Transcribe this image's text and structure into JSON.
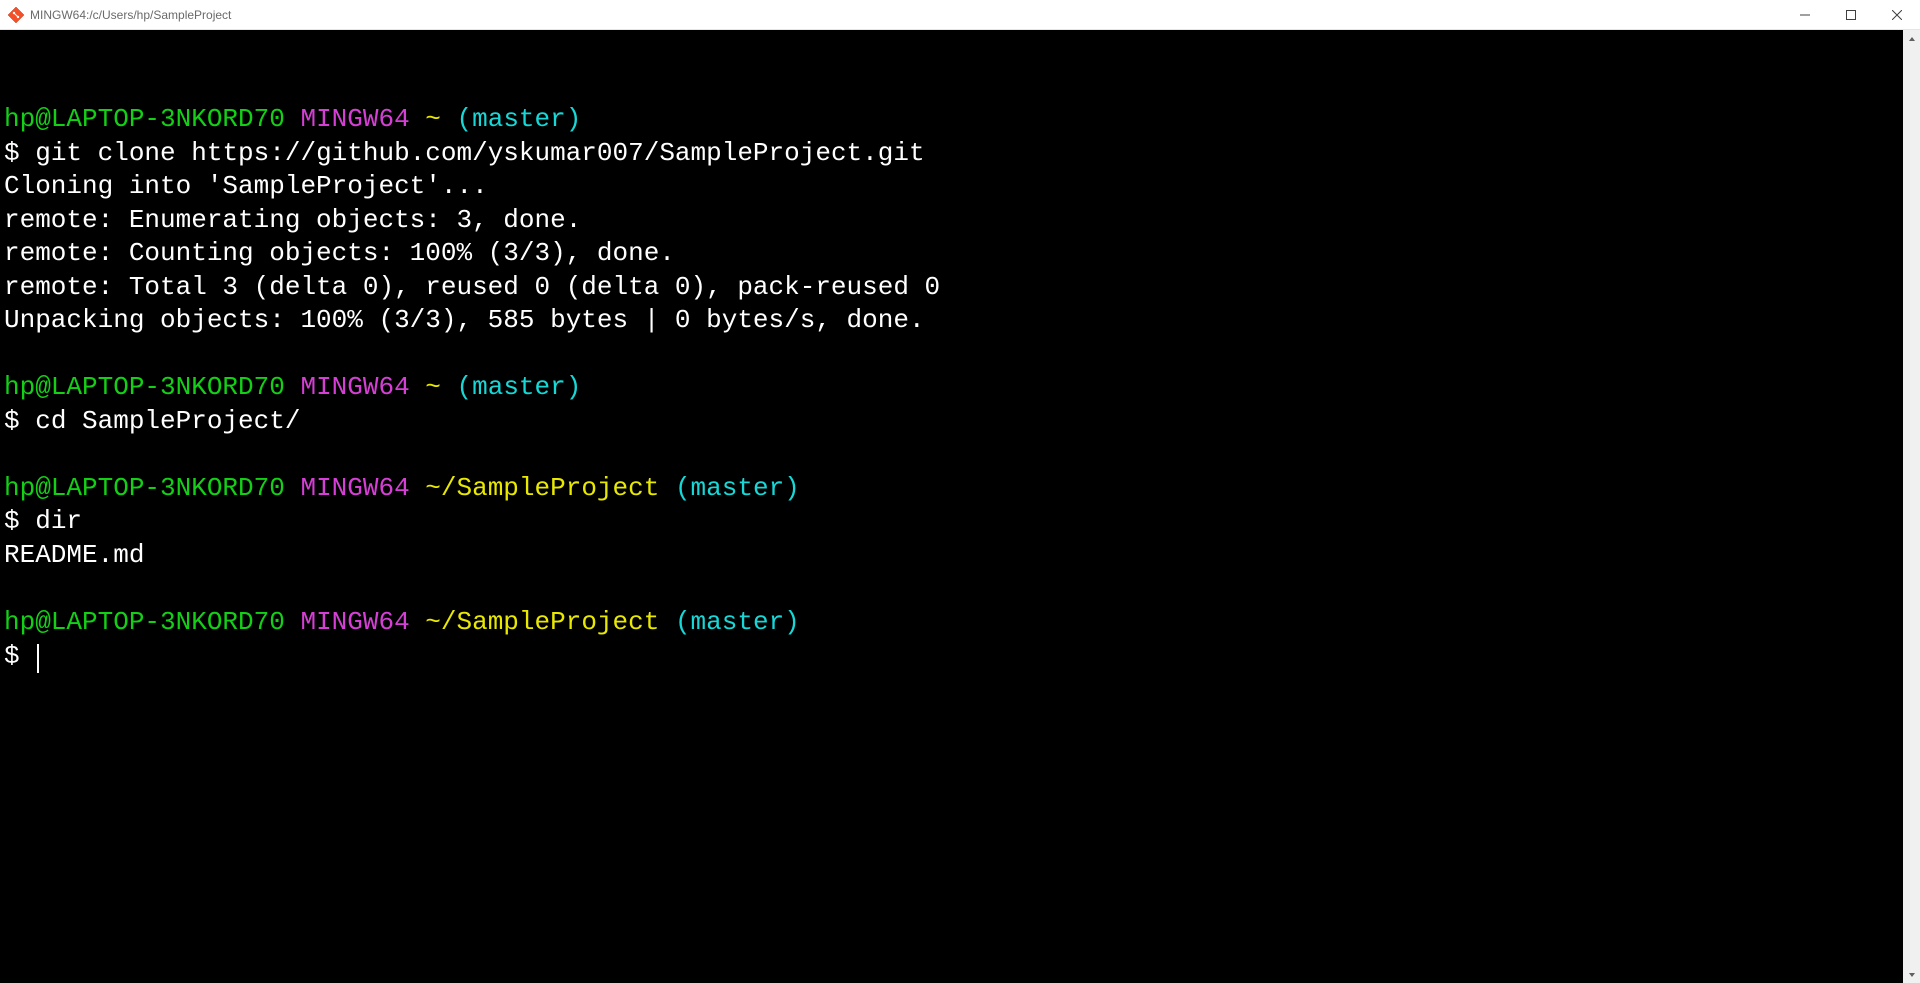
{
  "window": {
    "title": "MINGW64:/c/Users/hp/SampleProject"
  },
  "controls": {
    "minimize_label": "Minimize",
    "maximize_label": "Maximize",
    "close_label": "Close"
  },
  "colors": {
    "user": "#13d017",
    "env": "#d63fd6",
    "path": "#e8e800",
    "branch": "#17d7d7",
    "text": "#ffffff",
    "background": "#000000"
  },
  "prompt_segments": {
    "user_host": "hp@LAPTOP-3NKORD70",
    "env": "MINGW64",
    "path_home": "~",
    "path_project": "~/SampleProject",
    "branch": "(master)",
    "dollar": "$"
  },
  "commands": {
    "c1": "git clone https://github.com/yskumar007/SampleProject.git",
    "c2": "cd SampleProject/",
    "c3": "dir",
    "c4": ""
  },
  "output": {
    "clone_l1": "Cloning into 'SampleProject'...",
    "clone_l2": "remote: Enumerating objects: 3, done.",
    "clone_l3": "remote: Counting objects: 100% (3/3), done.",
    "clone_l4": "remote: Total 3 (delta 0), reused 0 (delta 0), pack-reused 0",
    "clone_l5": "Unpacking objects: 100% (3/3), 585 bytes | 0 bytes/s, done.",
    "dir_l1": "README.md"
  }
}
